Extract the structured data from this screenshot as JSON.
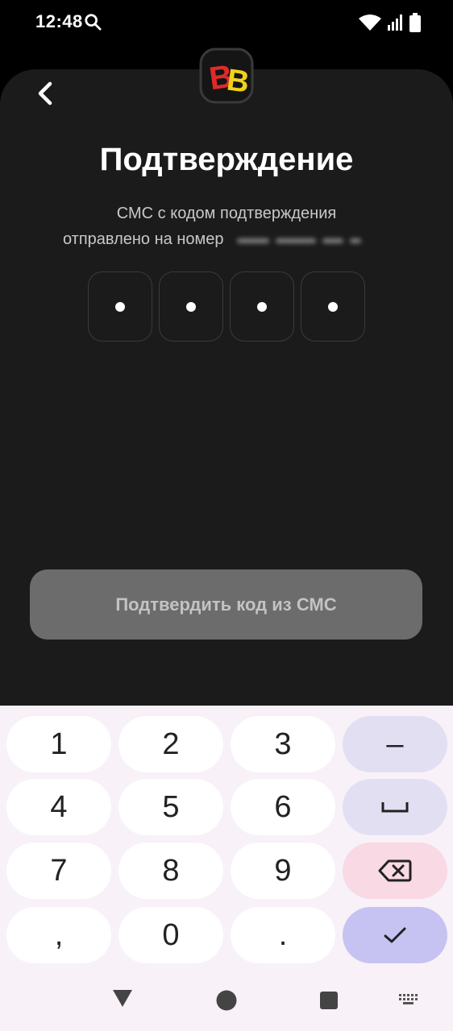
{
  "status_bar": {
    "time": "12:48"
  },
  "header": {
    "title": "Подтверждение"
  },
  "message": {
    "line1": "СМС с кодом подтверждения",
    "line2": "отправлено на номер"
  },
  "code": {
    "digits": [
      "•",
      "•",
      "•",
      "•"
    ]
  },
  "confirm_button": {
    "label": "Подтвердить код из СМС"
  },
  "keyboard": {
    "keys": [
      "1",
      "2",
      "3",
      "–",
      "4",
      "5",
      "6",
      "7",
      "8",
      "9",
      ",",
      "0",
      "."
    ]
  },
  "colors": {
    "background": "#1b1b1c",
    "button_disabled": "#6c6c6c",
    "keyboard_bg": "#f8f1f8",
    "key_fn": "#e3dff3",
    "key_delete": "#f8d9e4",
    "key_enter": "#c6c3f2"
  }
}
